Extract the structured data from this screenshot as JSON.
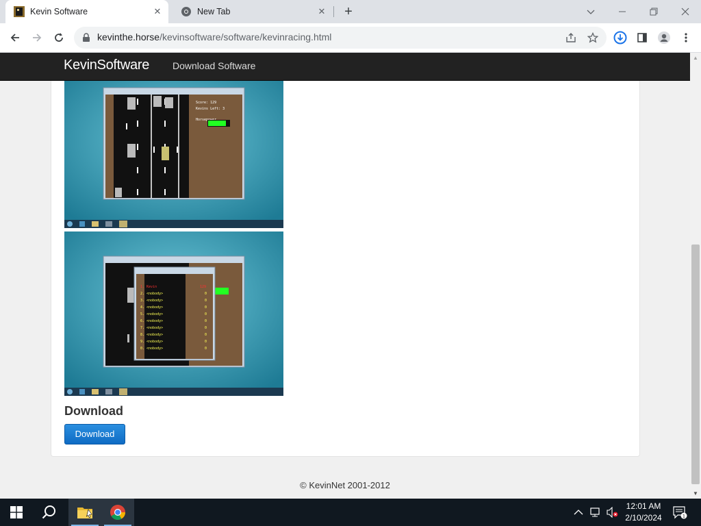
{
  "browser": {
    "tabs": [
      {
        "title": "Kevin Software",
        "active": true
      },
      {
        "title": "New Tab",
        "active": false
      }
    ],
    "url": {
      "host": "kevinthe.horse",
      "path": "/kevinsoftware/software/kevinracing.html"
    }
  },
  "site": {
    "brand": "KevinSoftware",
    "nav_link": "Download Software"
  },
  "content": {
    "screenshot1": {
      "score_text": "Score: 129",
      "lives_text": "Kevins Left: 3",
      "label": "Horsepower"
    },
    "screenshot2": {
      "rows": [
        "1. Kevin",
        "2. <nobody>",
        "3. <nobody>",
        "4. <nobody>",
        "5. <nobody>",
        "6. <nobody>",
        "7. <nobody>",
        "8. <nobody>",
        "9. <nobody>",
        "0. <nobody>"
      ],
      "scores": [
        "129",
        "0",
        "0",
        "0",
        "0",
        "0",
        "0",
        "0",
        "0",
        "0"
      ]
    },
    "download_heading": "Download",
    "download_button": "Download"
  },
  "footer": {
    "copyright": "© KevinNet 2001-2012"
  },
  "taskbar": {
    "time": "12:01 AM",
    "date": "2/10/2024",
    "notification_count": "1"
  },
  "colors": {
    "navbar": "#222222",
    "button_blue": "#1a7bd3",
    "taskbar": "#101820",
    "desktop_teal": "#2a8fa8",
    "game_brown": "#7a5a3c",
    "horsepower_green": "#22ff22"
  }
}
